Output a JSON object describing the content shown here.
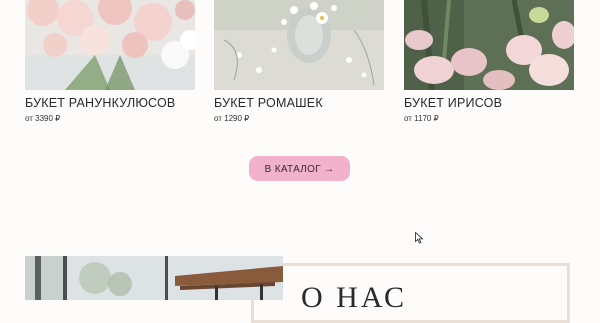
{
  "products": [
    {
      "title": "БУКЕТ РАНУНКУЛЮСОВ",
      "price": "от 3390 ₽",
      "image_icon": "ranunculus-bouquet-image"
    },
    {
      "title": "БУКЕТ РОМАШЕК",
      "price": "от 1290 ₽",
      "image_icon": "daisy-bouquet-image"
    },
    {
      "title": "БУКЕТ ИРИСОВ",
      "price": "от 1170 ₽",
      "image_icon": "iris-bouquet-image"
    }
  ],
  "catalog_button": {
    "label": "В КАТАЛОГ →"
  },
  "about": {
    "title": "О НАС"
  },
  "colors": {
    "accent_pink": "#f3b2cb",
    "frame_beige": "#eadfd6",
    "background": "#fdfcfb"
  }
}
